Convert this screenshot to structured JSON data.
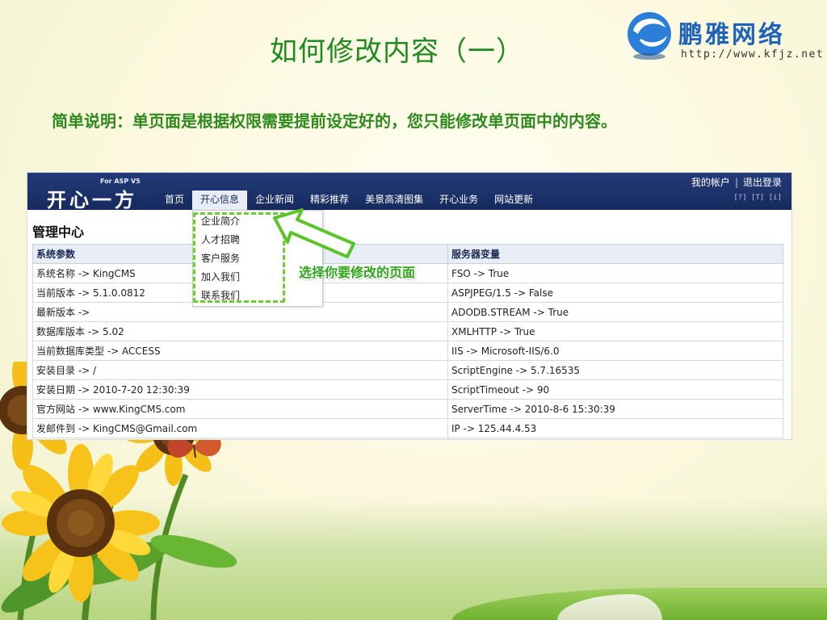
{
  "slide": {
    "title": "如何修改内容（一）",
    "subtitle": "简单说明：单页面是根据权限需要提前设定好的，您只能修改单页面中的内容。",
    "logo": {
      "name": "鹏雅网络",
      "url": "http://www.kfjz.net"
    }
  },
  "screenshot": {
    "brand": {
      "name": "开心一方",
      "tagline": "For ASP V5"
    },
    "account": {
      "my_account": "我的帐户",
      "logout": "退出登录"
    },
    "tools": "[?] [T] [i]",
    "nav": [
      {
        "label": "首页"
      },
      {
        "label": "开心信息",
        "active": true
      },
      {
        "label": "企业新闻"
      },
      {
        "label": "精彩推荐"
      },
      {
        "label": "美景高清图集"
      },
      {
        "label": "开心业务"
      },
      {
        "label": "网站更新"
      }
    ],
    "dropdown": {
      "items": [
        "企业简介",
        "人才招聘",
        "客户服务",
        "加入我们",
        "联系我们"
      ],
      "callout": "选择你要修改的页面"
    },
    "panel": {
      "title": "管理中心",
      "headers": [
        "系统参数",
        "服务器变量"
      ],
      "rows": [
        [
          "系统名称 -> KingCMS",
          "FSO -> True"
        ],
        [
          "当前版本 -> 5.1.0.0812",
          "ASPJPEG/1.5 -> False"
        ],
        [
          "最新版本 ->",
          "ADODB.STREAM -> True"
        ],
        [
          "数据库版本 -> 5.02",
          "XMLHTTP -> True"
        ],
        [
          "当前数据库类型 -> ACCESS",
          "IIS -> Microsoft-IIS/6.0"
        ],
        [
          "安装目录 -> /",
          "ScriptEngine -> 5.7.16535"
        ],
        [
          "安装日期 -> 2010-7-20 12:30:39",
          "ScriptTimeout -> 90"
        ],
        [
          "官方网站 -> www.KingCMS.com",
          "ServerTime -> 2010-8-6 15:30:39"
        ],
        [
          "发邮件到 -> KingCMS@Gmail.com",
          "IP -> 125.44.4.53"
        ]
      ]
    }
  }
}
